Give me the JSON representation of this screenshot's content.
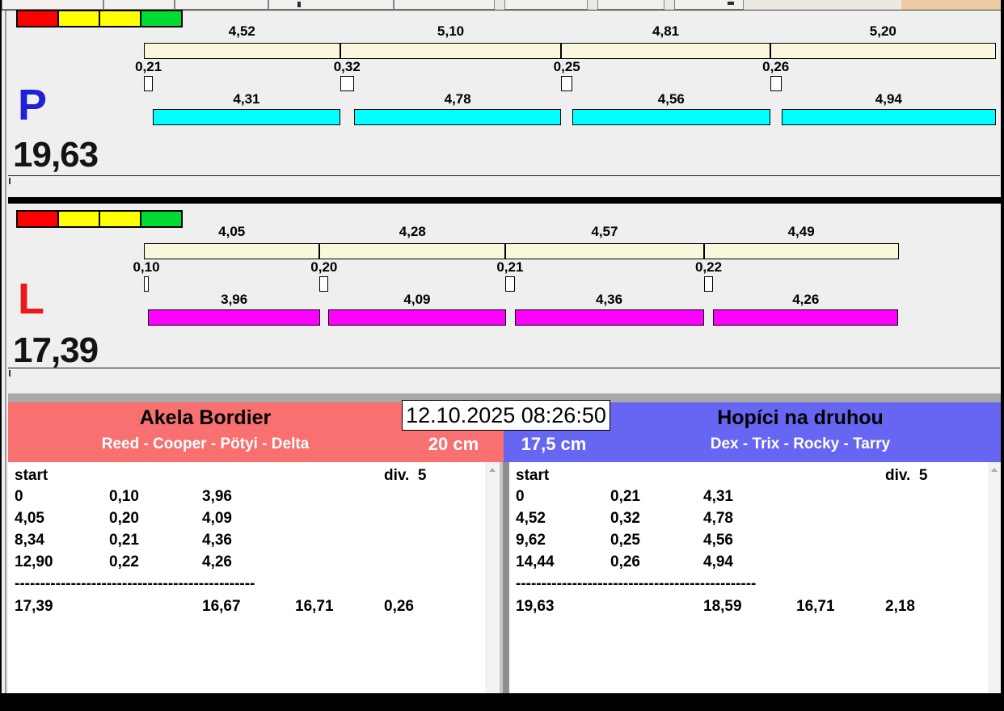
{
  "datetime": "12.10.2025 08:26:50",
  "lanes": [
    {
      "letter": "P",
      "letter_color": "#2020D6",
      "total": "19,63",
      "total_seconds": 19.63,
      "run_bar_color": "#00FFFF",
      "split_bar_color": "#FBF7DC",
      "traffic_colors": [
        "#FF0000",
        "#FFFF00",
        "#FFFF00",
        "#00DC32"
      ],
      "segments": [
        {
          "split_label": "4,52",
          "split": 4.52,
          "change_label": "0,21",
          "change": 0.21,
          "run_label": "4,31",
          "run": 4.31
        },
        {
          "split_label": "5,10",
          "split": 5.1,
          "change_label": "0,32",
          "change": 0.32,
          "run_label": "4,78",
          "run": 4.78
        },
        {
          "split_label": "4,81",
          "split": 4.81,
          "change_label": "0,25",
          "change": 0.25,
          "run_label": "4,56",
          "run": 4.56
        },
        {
          "split_label": "5,20",
          "split": 5.2,
          "change_label": "0,26",
          "change": 0.26,
          "run_label": "4,94",
          "run": 4.94
        }
      ]
    },
    {
      "letter": "L",
      "letter_color": "#EA1A1A",
      "total": "17,39",
      "total_seconds": 17.39,
      "run_bar_color": "#FF00FF",
      "split_bar_color": "#FBF7DC",
      "traffic_colors": [
        "#FF0000",
        "#FFFF00",
        "#FFFF00",
        "#00DC32"
      ],
      "segments": [
        {
          "split_label": "4,05",
          "split": 4.05,
          "change_label": "0,10",
          "change": 0.1,
          "run_label": "3,96",
          "run": 3.96
        },
        {
          "split_label": "4,28",
          "split": 4.28,
          "change_label": "0,20",
          "change": 0.2,
          "run_label": "4,09",
          "run": 4.09
        },
        {
          "split_label": "4,57",
          "split": 4.57,
          "change_label": "0,21",
          "change": 0.21,
          "run_label": "4,36",
          "run": 4.36
        },
        {
          "split_label": "4,49",
          "split": 4.49,
          "change_label": "0,22",
          "change": 0.22,
          "run_label": "4,26",
          "run": 4.26
        }
      ]
    }
  ],
  "teams": [
    {
      "name": "Akela Bordier",
      "dogs": "Reed - Cooper - Pötyi - Delta",
      "jump_height": "20 cm",
      "header_color": "#F87070",
      "start_label": "start",
      "division_label": "div.  5",
      "rows": [
        [
          "0",
          "0,10",
          "3,96"
        ],
        [
          "4,05",
          "0,20",
          "4,09"
        ],
        [
          "8,34",
          "0,21",
          "4,36"
        ],
        [
          "12,90",
          "0,22",
          "4,26"
        ]
      ],
      "separator": "-----------------------------------------------",
      "totals": [
        "17,39",
        "16,67",
        "16,71",
        "0,26"
      ]
    },
    {
      "name": "Hopíci na druhou",
      "dogs": "Dex - Trix - Rocky - Tarry",
      "jump_height": "17,5 cm",
      "header_color": "#6666F2",
      "start_label": "start",
      "division_label": "div.  5",
      "rows": [
        [
          "0",
          "0,21",
          "4,31"
        ],
        [
          "4,52",
          "0,32",
          "4,78"
        ],
        [
          "9,62",
          "0,25",
          "4,56"
        ],
        [
          "14,44",
          "0,26",
          "4,94"
        ]
      ],
      "separator": "-----------------------------------------------",
      "totals": [
        "19,63",
        "18,59",
        "16,71",
        "2,18"
      ]
    }
  ]
}
